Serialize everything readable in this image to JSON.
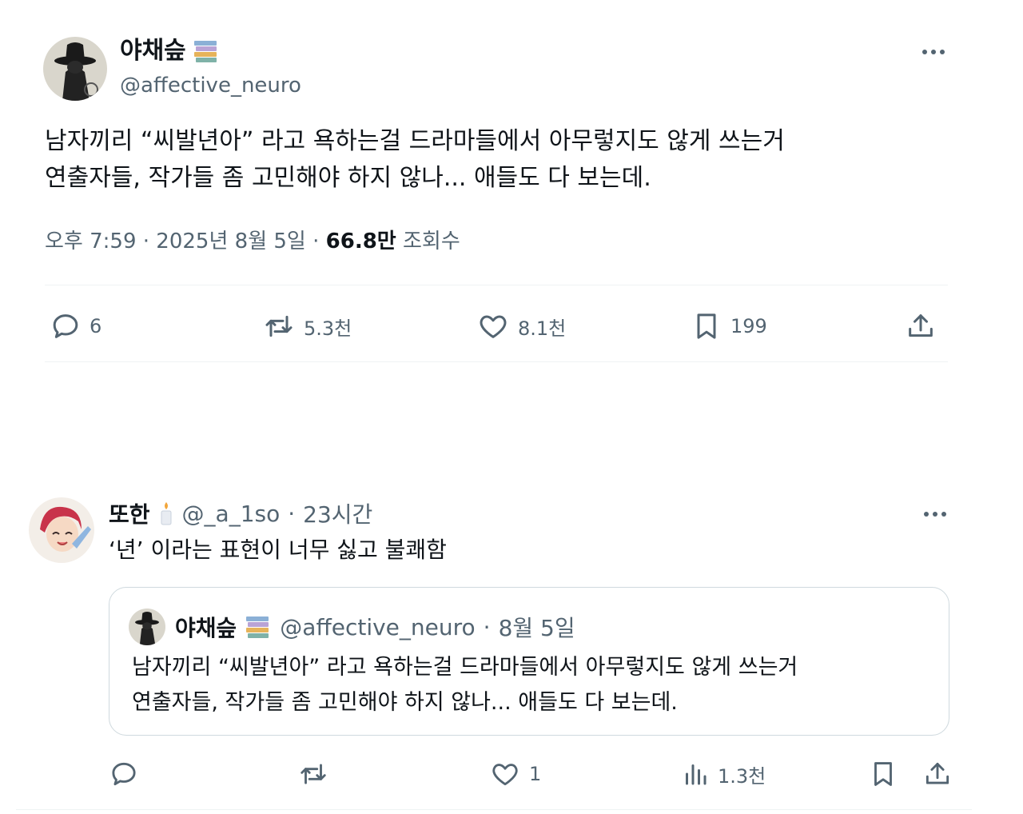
{
  "main_tweet": {
    "author_name": "야채슾",
    "author_emoji": "books-emoji",
    "handle": "@affective_neuro",
    "text_lines": [
      "남자끼리 “씨발년아” 라고 욕하는걸 드라마들에서 아무렇지도 않게 쓰는거",
      "연출자들, 작가들 좀 고민해야 하지 않나... 애들도 다 보는데."
    ],
    "time": "오후 7:59",
    "date": "2025년 8월 5일",
    "separator": "·",
    "views_count": "66.8만",
    "views_label": "조회수",
    "replies": "6",
    "reposts": "5.3천",
    "likes": "8.1천",
    "bookmarks": "199"
  },
  "reply_tweet": {
    "author_name": "또한",
    "author_emoji": "candle-emoji",
    "handle": "@_a_1so",
    "separator": "·",
    "time_ago": "23시간",
    "text": "‘년’ 이라는 표현이 너무 싫고 불쾌함",
    "replies": "",
    "reposts": "",
    "likes": "1",
    "views": "1.3천",
    "quoted": {
      "author_name": "야채슾",
      "handle": "@affective_neuro",
      "separator": "·",
      "date": "8월 5일",
      "text_lines": [
        "남자끼리 “씨발년아” 라고 욕하는걸 드라마들에서 아무렇지도 않게 쓰는거",
        "연출자들, 작가들 좀 고민해야 하지 않나... 애들도 다 보는데."
      ]
    }
  },
  "colors": {
    "text_primary": "#0f1419",
    "text_secondary": "#536471",
    "border": "#cfd9de",
    "divider": "#eff3f4"
  }
}
